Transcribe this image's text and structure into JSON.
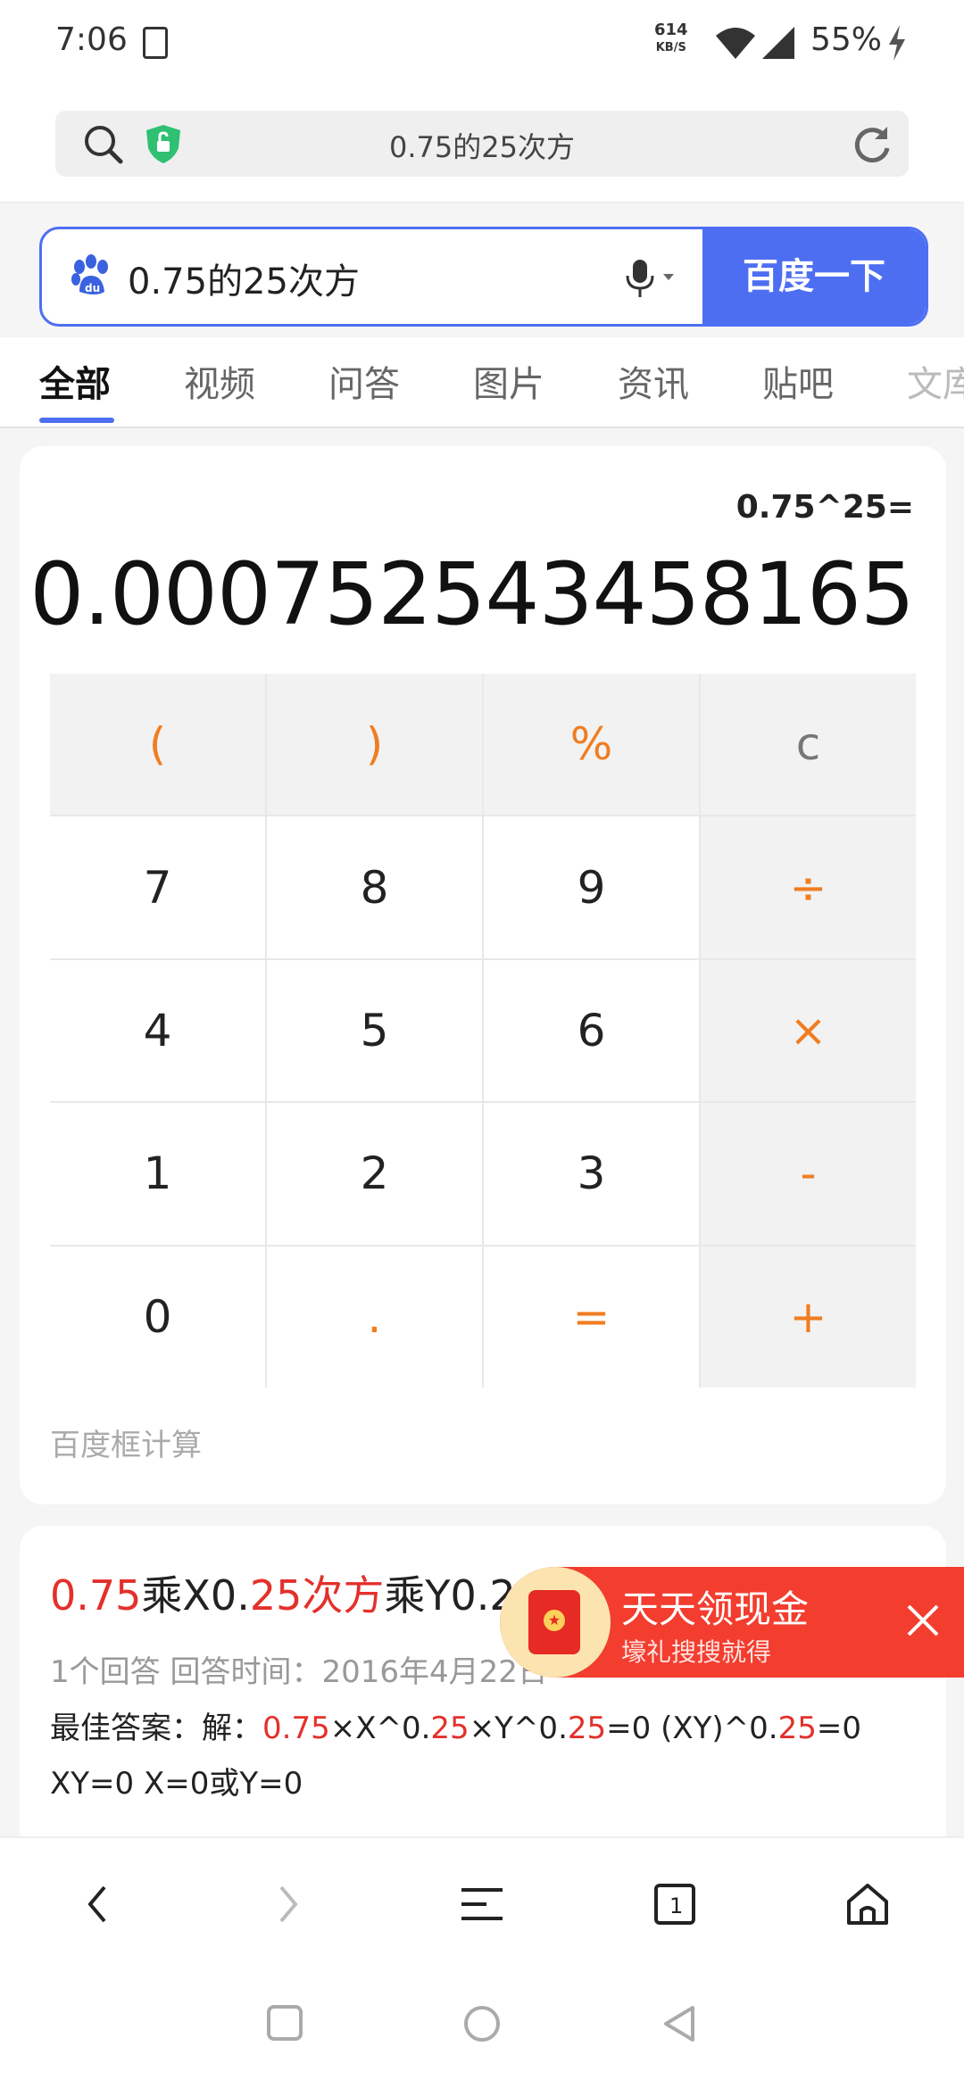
{
  "status_bar": {
    "time": "7:06",
    "speed_value": "614",
    "speed_unit": "KB/S",
    "battery": "55%"
  },
  "url_bar": {
    "text": "0.75的25次方"
  },
  "search": {
    "query": "0.75的25次方",
    "button_label": "百度一下"
  },
  "tabs": [
    "全部",
    "视频",
    "问答",
    "图片",
    "资讯",
    "贴吧",
    "文库"
  ],
  "calculator": {
    "expression": "0.75^25=",
    "result": "0.000752543458165",
    "keys": [
      "(",
      ")",
      "%",
      "c",
      "7",
      "8",
      "9",
      "÷",
      "4",
      "5",
      "6",
      "×",
      "1",
      "2",
      "3",
      "-",
      "0",
      ".",
      "=",
      "+"
    ],
    "caption": "百度框计算"
  },
  "answer": {
    "title_parts": [
      "0.75",
      "乘X0.",
      "25次方",
      "乘Y0.2"
    ],
    "meta": "1个回答  回答时间：2016年4月22日",
    "best_label": "最佳答案：解：",
    "best_parts": [
      "0.75",
      "×X^0.",
      "25",
      "×Y^0.",
      "25",
      "=0 (XY)^0.",
      "25",
      "=0 XY=0 X=0或Y=0"
    ]
  },
  "promo": {
    "title": "天天领现金",
    "subtitle": "壕礼搜搜就得"
  },
  "colors": {
    "brand_blue": "#4e6ef2",
    "orange": "#f07d21",
    "red": "#e4302b"
  }
}
